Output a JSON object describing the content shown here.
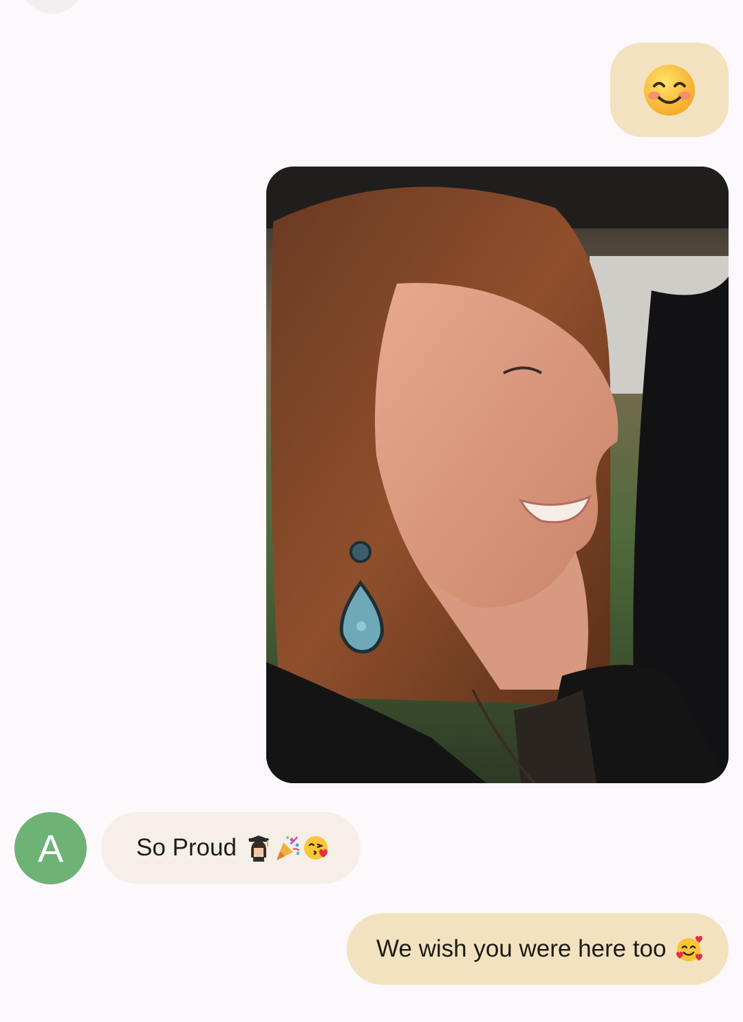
{
  "conversation": {
    "messages": [
      {
        "direction": "outgoing",
        "kind": "emoji",
        "icon": "smiling-face-with-smiling-eyes-icon"
      },
      {
        "direction": "outgoing",
        "kind": "photo",
        "icon": "photo-woman-smiling-profile"
      },
      {
        "direction": "incoming",
        "kind": "text",
        "sender_initial": "A",
        "text": "So Proud",
        "emojis": [
          "woman-student-icon",
          "party-popper-icon",
          "face-blowing-kiss-icon"
        ]
      },
      {
        "direction": "outgoing",
        "kind": "text",
        "text": "We wish you were here too",
        "emojis": [
          "smiling-face-with-hearts-icon"
        ]
      }
    ]
  },
  "colors": {
    "background": "#fcf8fb",
    "outgoing_bubble": "#f2e2bf",
    "incoming_bubble": "#f6efe8",
    "avatar": "#6eb276",
    "text": "#1f1b16"
  }
}
